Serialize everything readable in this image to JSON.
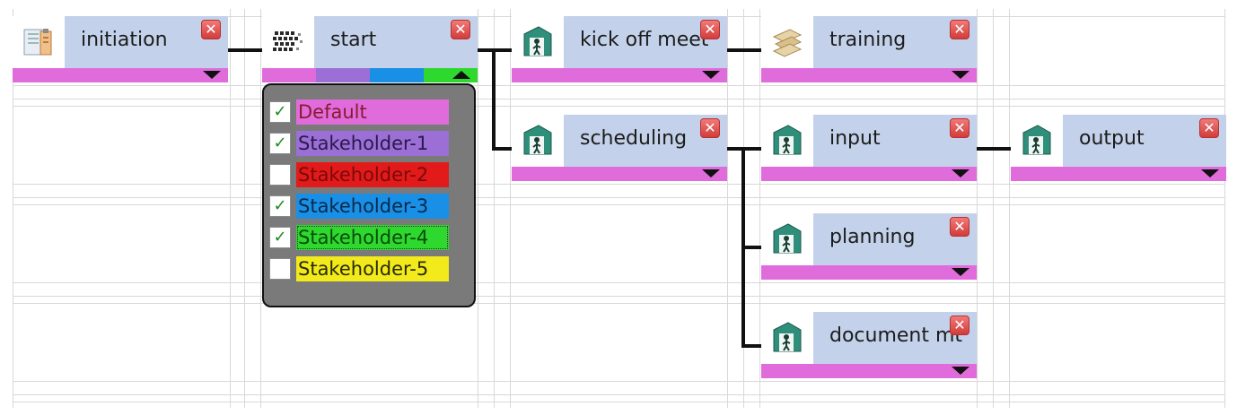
{
  "colors": {
    "default": "#e06cdc",
    "stakeholder1": "#9b6fd6",
    "stakeholder2": "#e21a1a",
    "stakeholder3": "#1a8fe6",
    "stakeholder4": "#2ed82e",
    "stakeholder5": "#f2ea1a",
    "label_bg": "#c3d2ea"
  },
  "nodes": {
    "initiation": {
      "label": "initiation",
      "icon": "document-clipboard-icon"
    },
    "start": {
      "label": "start",
      "icon": "matrix-grid-icon"
    },
    "kickoff": {
      "label": "kick off meet",
      "icon": "person-door-icon"
    },
    "training": {
      "label": "training",
      "icon": "stacked-papers-icon"
    },
    "scheduling": {
      "label": "scheduling",
      "icon": "person-door-icon"
    },
    "input": {
      "label": "input",
      "icon": "person-door-icon"
    },
    "output": {
      "label": "output",
      "icon": "person-door-icon"
    },
    "planning": {
      "label": "planning",
      "icon": "person-door-icon"
    },
    "document": {
      "label": "document mt",
      "icon": "person-door-icon"
    }
  },
  "close_glyph": "✕",
  "stakeholder_popup": {
    "options": [
      {
        "label": "Default",
        "checked": true
      },
      {
        "label": "Stakeholder-1",
        "checked": true
      },
      {
        "label": "Stakeholder-2",
        "checked": false
      },
      {
        "label": "Stakeholder-3",
        "checked": true
      },
      {
        "label": "Stakeholder-4",
        "checked": true
      },
      {
        "label": "Stakeholder-5",
        "checked": false
      }
    ],
    "check_glyph": "✓"
  }
}
